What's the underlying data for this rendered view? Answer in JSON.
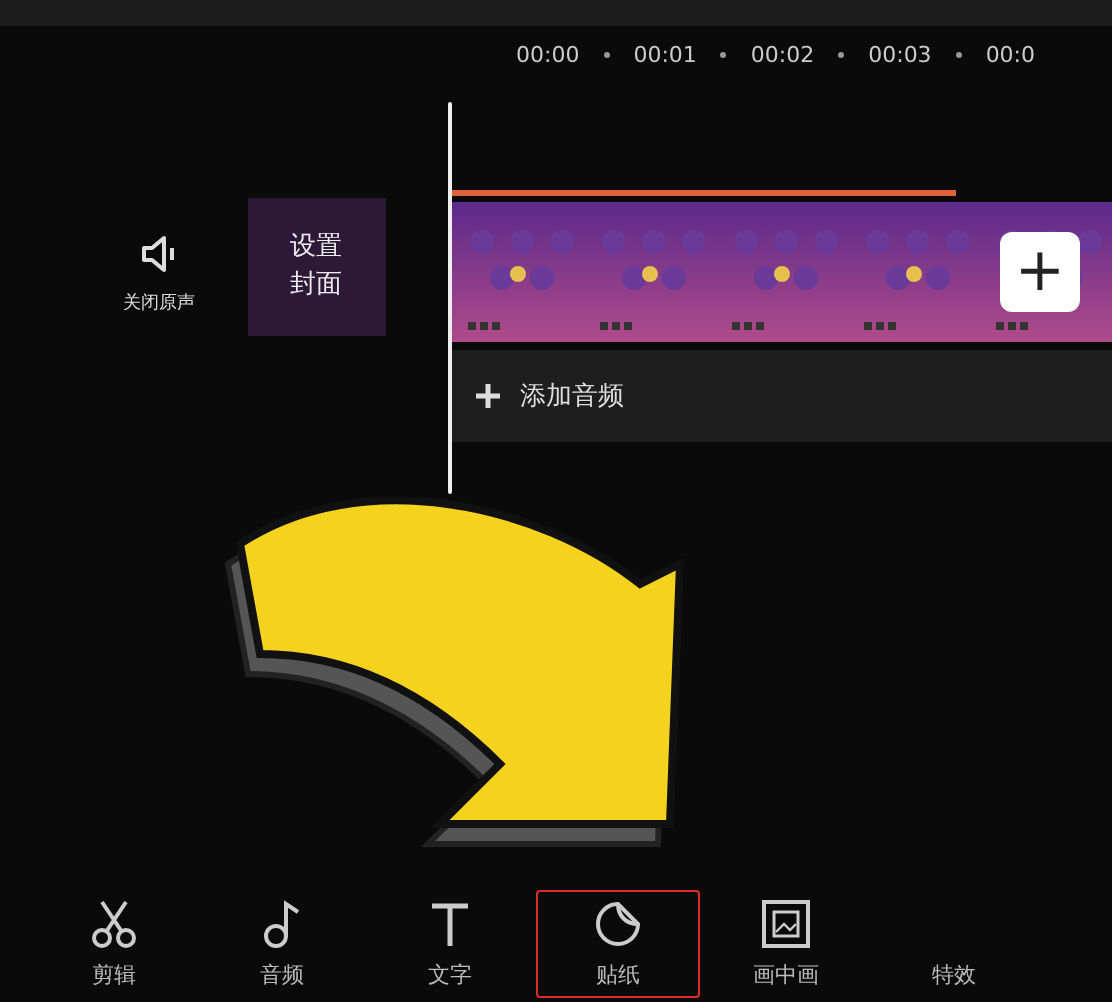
{
  "ruler": {
    "ticks": [
      "00:00",
      "00:01",
      "00:02",
      "00:03",
      "00:0"
    ]
  },
  "mute_button": {
    "label": "关闭原声"
  },
  "cover_button": {
    "label": "设置封面"
  },
  "video_track": {
    "add_button": "+"
  },
  "audio_track": {
    "label": "添加音频"
  },
  "toolbar": [
    {
      "label": "剪辑",
      "kind": "scissors",
      "selected": false
    },
    {
      "label": "音频",
      "kind": "note",
      "selected": false
    },
    {
      "label": "文字",
      "kind": "text",
      "selected": false
    },
    {
      "label": "贴纸",
      "kind": "sticker",
      "selected": true
    },
    {
      "label": "画中画",
      "kind": "pip",
      "selected": false
    },
    {
      "label": "特效",
      "kind": "plain",
      "selected": false
    }
  ]
}
